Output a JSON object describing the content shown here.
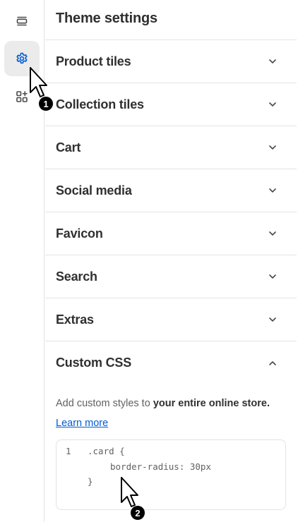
{
  "rail": {
    "items": [
      {
        "icon": "sections-icon"
      },
      {
        "icon": "gear-icon",
        "active": true
      },
      {
        "icon": "add-app-block-icon"
      }
    ]
  },
  "panel": {
    "title": "Theme settings",
    "sections": [
      {
        "label": "Product tiles",
        "expanded": false
      },
      {
        "label": "Collection tiles",
        "expanded": false
      },
      {
        "label": "Cart",
        "expanded": false
      },
      {
        "label": "Social media",
        "expanded": false
      },
      {
        "label": "Favicon",
        "expanded": false
      },
      {
        "label": "Search",
        "expanded": false
      },
      {
        "label": "Extras",
        "expanded": false
      },
      {
        "label": "Custom CSS",
        "expanded": true
      }
    ]
  },
  "custom_css": {
    "description_prefix": "Add custom styles to ",
    "description_bold": "your entire online store.",
    "learn_more": "Learn more",
    "line_number": "1",
    "code_lines": [
      ".card {",
      "border-radius: 30px",
      "}"
    ]
  },
  "annotations": {
    "cursor_1_badge": "1",
    "cursor_2_badge": "2"
  },
  "colors": {
    "accent": "#005bd3",
    "text": "#303030",
    "muted": "#616161",
    "border": "#e3e3e3",
    "active_bg": "#ebebeb"
  }
}
